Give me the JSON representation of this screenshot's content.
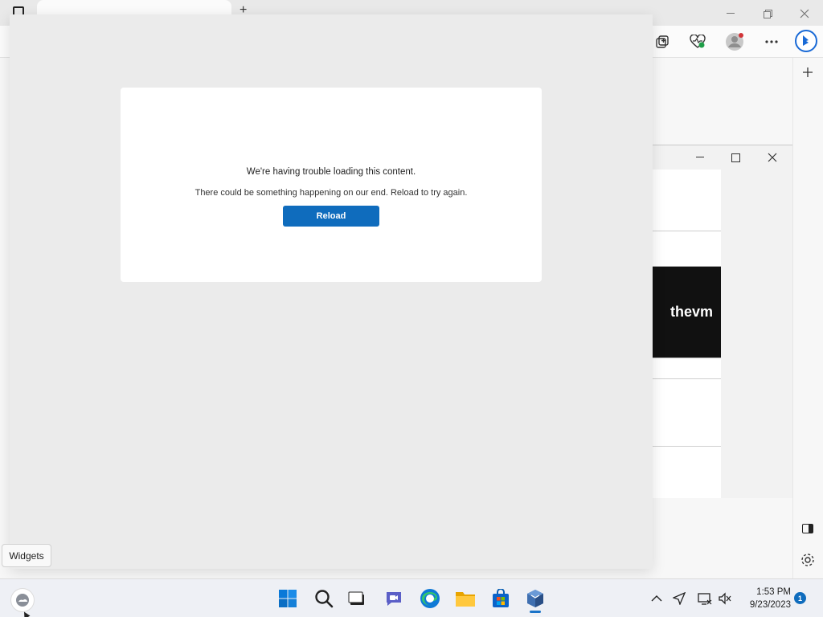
{
  "edge": {
    "tab_title": "",
    "icons": [
      "collections-icon",
      "browser-essentials-icon",
      "profile-icon",
      "more-icon",
      "bing-copilot-icon",
      "add-icon"
    ],
    "window_controls": [
      "minimize-icon",
      "restore-icon",
      "close-icon"
    ]
  },
  "subwindow": {
    "thumbnail_text": "thevm"
  },
  "widgets": {
    "error_title": "We're having trouble loading this content.",
    "error_message": "There could be something happening on our end. Reload to try again.",
    "reload_label": "Reload"
  },
  "tooltip": {
    "label": "Widgets"
  },
  "taskbar": {
    "apps": [
      "start-icon",
      "search-icon",
      "task-view-icon",
      "teams-chat-icon",
      "edge-icon",
      "file-explorer-icon",
      "store-icon",
      "virtualbox-icon"
    ],
    "active_app": "virtualbox-icon",
    "time": "1:53 PM",
    "date": "9/23/2023",
    "notification_count": "1"
  },
  "colors": {
    "accent": "#0f6cbd",
    "panel_bg": "#ebebeb"
  }
}
